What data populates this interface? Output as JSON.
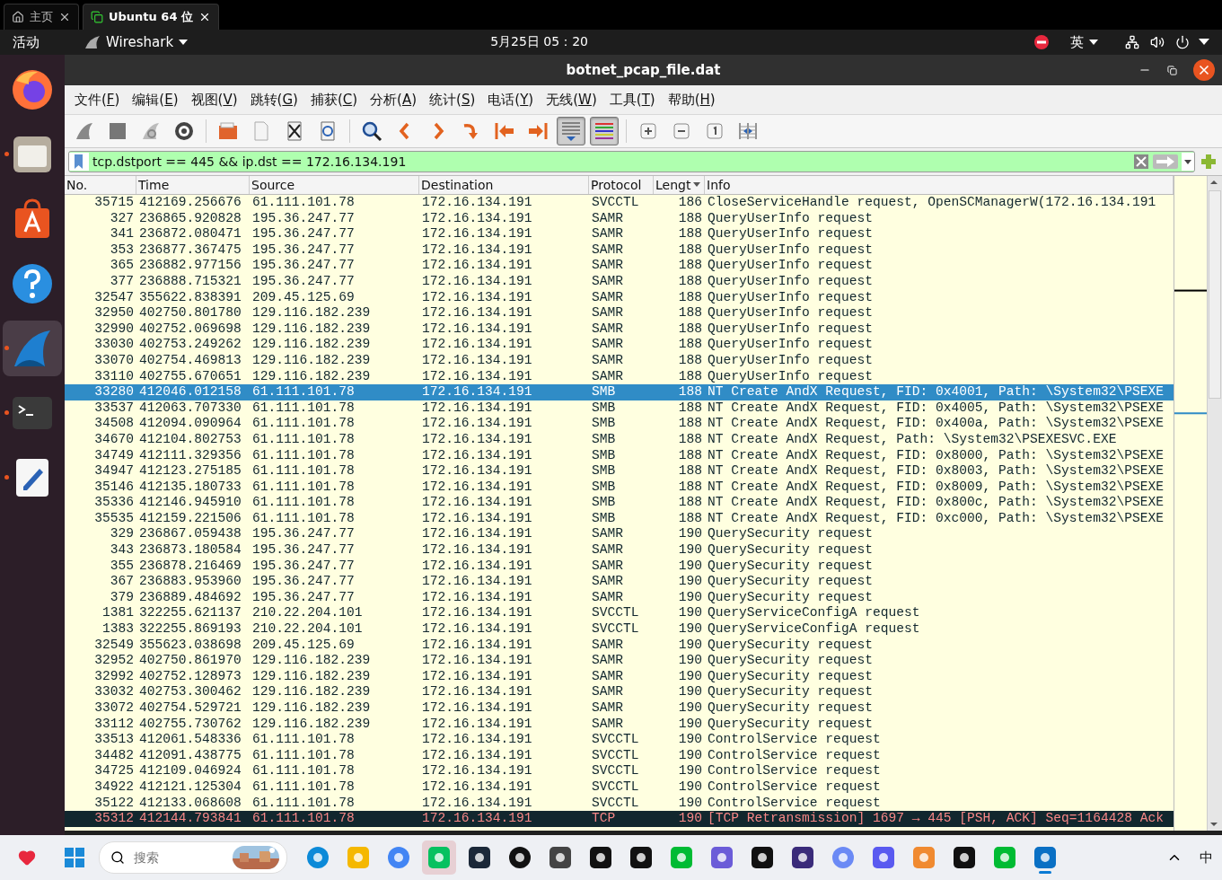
{
  "browser_tabs": [
    {
      "label": "主页",
      "selected": false
    },
    {
      "label": "Ubuntu 64 位",
      "selected": true
    }
  ],
  "top_panel": {
    "activities": "活动",
    "app_menu": "Wireshark",
    "clock": "5月25日  05：20",
    "input_method": "英"
  },
  "dock": [
    {
      "running": false,
      "focused": false
    },
    {
      "running": true,
      "focused": false
    },
    {
      "running": false,
      "focused": false
    },
    {
      "running": false,
      "focused": false
    },
    {
      "running": true,
      "focused": true
    },
    {
      "running": true,
      "focused": false
    },
    {
      "running": true,
      "focused": false
    }
  ],
  "window": {
    "title": "botnet_pcap_file.dat"
  },
  "menu": [
    "文件(F)",
    "编辑(E)",
    "视图(V)",
    "跳转(G)",
    "捕获(C)",
    "分析(A)",
    "统计(S)",
    "电话(Y)",
    "无线(W)",
    "工具(T)",
    "帮助(H)"
  ],
  "toolbar": [
    {
      "kind": "start",
      "pressed": false
    },
    {
      "kind": "stop",
      "pressed": false
    },
    {
      "kind": "restart",
      "pressed": false
    },
    {
      "kind": "options",
      "pressed": false
    },
    {
      "kind": "separator"
    },
    {
      "kind": "open",
      "pressed": false
    },
    {
      "kind": "save",
      "pressed": false
    },
    {
      "kind": "close",
      "pressed": false
    },
    {
      "kind": "reload",
      "pressed": false
    },
    {
      "kind": "separator"
    },
    {
      "kind": "find",
      "pressed": false
    },
    {
      "kind": "back",
      "pressed": false
    },
    {
      "kind": "forward",
      "pressed": false
    },
    {
      "kind": "goto",
      "pressed": false
    },
    {
      "kind": "first",
      "pressed": false
    },
    {
      "kind": "last",
      "pressed": false
    },
    {
      "kind": "autoscroll",
      "pressed": true
    },
    {
      "kind": "colorize",
      "pressed": true
    },
    {
      "kind": "separator"
    },
    {
      "kind": "zoom_in",
      "pressed": false
    },
    {
      "kind": "zoom_out",
      "pressed": false
    },
    {
      "kind": "normal_size",
      "pressed": false
    },
    {
      "kind": "resize_columns",
      "pressed": false
    }
  ],
  "filter": {
    "value": "tcp.dstport == 445 && ip.dst == 172.16.134.191",
    "valid": true
  },
  "table": {
    "columns": [
      "No.",
      "Time",
      "Source",
      "Destination",
      "Protocol",
      "Lengt",
      "Info"
    ],
    "rows": [
      {
        "no": "35715",
        "time": "412169.256676",
        "source": "61.111.101.78",
        "destination": "172.16.134.191",
        "protocol": "SVCCTL",
        "length": "186",
        "info": "CloseServiceHandle request, OpenSCManagerW(172.16.134.191",
        "kind": "normal",
        "selected": false
      },
      {
        "no": "327",
        "time": "236865.920828",
        "source": "195.36.247.77",
        "destination": "172.16.134.191",
        "protocol": "SAMR",
        "length": "188",
        "info": "QueryUserInfo request",
        "kind": "normal",
        "selected": false
      },
      {
        "no": "341",
        "time": "236872.080471",
        "source": "195.36.247.77",
        "destination": "172.16.134.191",
        "protocol": "SAMR",
        "length": "188",
        "info": "QueryUserInfo request",
        "kind": "normal",
        "selected": false
      },
      {
        "no": "353",
        "time": "236877.367475",
        "source": "195.36.247.77",
        "destination": "172.16.134.191",
        "protocol": "SAMR",
        "length": "188",
        "info": "QueryUserInfo request",
        "kind": "normal",
        "selected": false
      },
      {
        "no": "365",
        "time": "236882.977156",
        "source": "195.36.247.77",
        "destination": "172.16.134.191",
        "protocol": "SAMR",
        "length": "188",
        "info": "QueryUserInfo request",
        "kind": "normal",
        "selected": false
      },
      {
        "no": "377",
        "time": "236888.715321",
        "source": "195.36.247.77",
        "destination": "172.16.134.191",
        "protocol": "SAMR",
        "length": "188",
        "info": "QueryUserInfo request",
        "kind": "normal",
        "selected": false
      },
      {
        "no": "32547",
        "time": "355622.838391",
        "source": "209.45.125.69",
        "destination": "172.16.134.191",
        "protocol": "SAMR",
        "length": "188",
        "info": "QueryUserInfo request",
        "kind": "normal",
        "selected": false
      },
      {
        "no": "32950",
        "time": "402750.801780",
        "source": "129.116.182.239",
        "destination": "172.16.134.191",
        "protocol": "SAMR",
        "length": "188",
        "info": "QueryUserInfo request",
        "kind": "normal",
        "selected": false
      },
      {
        "no": "32990",
        "time": "402752.069698",
        "source": "129.116.182.239",
        "destination": "172.16.134.191",
        "protocol": "SAMR",
        "length": "188",
        "info": "QueryUserInfo request",
        "kind": "normal",
        "selected": false
      },
      {
        "no": "33030",
        "time": "402753.249262",
        "source": "129.116.182.239",
        "destination": "172.16.134.191",
        "protocol": "SAMR",
        "length": "188",
        "info": "QueryUserInfo request",
        "kind": "normal",
        "selected": false
      },
      {
        "no": "33070",
        "time": "402754.469813",
        "source": "129.116.182.239",
        "destination": "172.16.134.191",
        "protocol": "SAMR",
        "length": "188",
        "info": "QueryUserInfo request",
        "kind": "normal",
        "selected": false
      },
      {
        "no": "33110",
        "time": "402755.670651",
        "source": "129.116.182.239",
        "destination": "172.16.134.191",
        "protocol": "SAMR",
        "length": "188",
        "info": "QueryUserInfo request",
        "kind": "normal",
        "selected": false
      },
      {
        "no": "33280",
        "time": "412046.012158",
        "source": "61.111.101.78",
        "destination": "172.16.134.191",
        "protocol": "SMB",
        "length": "188",
        "info": "NT Create AndX Request, FID: 0x4001, Path: \\System32\\PSEXE",
        "kind": "normal",
        "selected": true
      },
      {
        "no": "33537",
        "time": "412063.707330",
        "source": "61.111.101.78",
        "destination": "172.16.134.191",
        "protocol": "SMB",
        "length": "188",
        "info": "NT Create AndX Request, FID: 0x4005, Path: \\System32\\PSEXE",
        "kind": "normal",
        "selected": false
      },
      {
        "no": "34508",
        "time": "412094.090964",
        "source": "61.111.101.78",
        "destination": "172.16.134.191",
        "protocol": "SMB",
        "length": "188",
        "info": "NT Create AndX Request, FID: 0x400a, Path: \\System32\\PSEXE",
        "kind": "normal",
        "selected": false
      },
      {
        "no": "34670",
        "time": "412104.802753",
        "source": "61.111.101.78",
        "destination": "172.16.134.191",
        "protocol": "SMB",
        "length": "188",
        "info": "NT Create AndX Request, Path: \\System32\\PSEXESVC.EXE",
        "kind": "normal",
        "selected": false
      },
      {
        "no": "34749",
        "time": "412111.329356",
        "source": "61.111.101.78",
        "destination": "172.16.134.191",
        "protocol": "SMB",
        "length": "188",
        "info": "NT Create AndX Request, FID: 0x8000, Path: \\System32\\PSEXE",
        "kind": "normal",
        "selected": false
      },
      {
        "no": "34947",
        "time": "412123.275185",
        "source": "61.111.101.78",
        "destination": "172.16.134.191",
        "protocol": "SMB",
        "length": "188",
        "info": "NT Create AndX Request, FID: 0x8003, Path: \\System32\\PSEXE",
        "kind": "normal",
        "selected": false
      },
      {
        "no": "35146",
        "time": "412135.180733",
        "source": "61.111.101.78",
        "destination": "172.16.134.191",
        "protocol": "SMB",
        "length": "188",
        "info": "NT Create AndX Request, FID: 0x8009, Path: \\System32\\PSEXE",
        "kind": "normal",
        "selected": false
      },
      {
        "no": "35336",
        "time": "412146.945910",
        "source": "61.111.101.78",
        "destination": "172.16.134.191",
        "protocol": "SMB",
        "length": "188",
        "info": "NT Create AndX Request, FID: 0x800c, Path: \\System32\\PSEXE",
        "kind": "normal",
        "selected": false
      },
      {
        "no": "35535",
        "time": "412159.221506",
        "source": "61.111.101.78",
        "destination": "172.16.134.191",
        "protocol": "SMB",
        "length": "188",
        "info": "NT Create AndX Request, FID: 0xc000, Path: \\System32\\PSEXE",
        "kind": "normal",
        "selected": false
      },
      {
        "no": "329",
        "time": "236867.059438",
        "source": "195.36.247.77",
        "destination": "172.16.134.191",
        "protocol": "SAMR",
        "length": "190",
        "info": "QuerySecurity request",
        "kind": "normal",
        "selected": false
      },
      {
        "no": "343",
        "time": "236873.180584",
        "source": "195.36.247.77",
        "destination": "172.16.134.191",
        "protocol": "SAMR",
        "length": "190",
        "info": "QuerySecurity request",
        "kind": "normal",
        "selected": false
      },
      {
        "no": "355",
        "time": "236878.216469",
        "source": "195.36.247.77",
        "destination": "172.16.134.191",
        "protocol": "SAMR",
        "length": "190",
        "info": "QuerySecurity request",
        "kind": "normal",
        "selected": false
      },
      {
        "no": "367",
        "time": "236883.953960",
        "source": "195.36.247.77",
        "destination": "172.16.134.191",
        "protocol": "SAMR",
        "length": "190",
        "info": "QuerySecurity request",
        "kind": "normal",
        "selected": false
      },
      {
        "no": "379",
        "time": "236889.484692",
        "source": "195.36.247.77",
        "destination": "172.16.134.191",
        "protocol": "SAMR",
        "length": "190",
        "info": "QuerySecurity request",
        "kind": "normal",
        "selected": false
      },
      {
        "no": "1381",
        "time": "322255.621137",
        "source": "210.22.204.101",
        "destination": "172.16.134.191",
        "protocol": "SVCCTL",
        "length": "190",
        "info": "QueryServiceConfigA request",
        "kind": "normal",
        "selected": false
      },
      {
        "no": "1383",
        "time": "322255.869193",
        "source": "210.22.204.101",
        "destination": "172.16.134.191",
        "protocol": "SVCCTL",
        "length": "190",
        "info": "QueryServiceConfigA request",
        "kind": "normal",
        "selected": false
      },
      {
        "no": "32549",
        "time": "355623.038698",
        "source": "209.45.125.69",
        "destination": "172.16.134.191",
        "protocol": "SAMR",
        "length": "190",
        "info": "QuerySecurity request",
        "kind": "normal",
        "selected": false
      },
      {
        "no": "32952",
        "time": "402750.861970",
        "source": "129.116.182.239",
        "destination": "172.16.134.191",
        "protocol": "SAMR",
        "length": "190",
        "info": "QuerySecurity request",
        "kind": "normal",
        "selected": false
      },
      {
        "no": "32992",
        "time": "402752.128973",
        "source": "129.116.182.239",
        "destination": "172.16.134.191",
        "protocol": "SAMR",
        "length": "190",
        "info": "QuerySecurity request",
        "kind": "normal",
        "selected": false
      },
      {
        "no": "33032",
        "time": "402753.300462",
        "source": "129.116.182.239",
        "destination": "172.16.134.191",
        "protocol": "SAMR",
        "length": "190",
        "info": "QuerySecurity request",
        "kind": "normal",
        "selected": false
      },
      {
        "no": "33072",
        "time": "402754.529721",
        "source": "129.116.182.239",
        "destination": "172.16.134.191",
        "protocol": "SAMR",
        "length": "190",
        "info": "QuerySecurity request",
        "kind": "normal",
        "selected": false
      },
      {
        "no": "33112",
        "time": "402755.730762",
        "source": "129.116.182.239",
        "destination": "172.16.134.191",
        "protocol": "SAMR",
        "length": "190",
        "info": "QuerySecurity request",
        "kind": "normal",
        "selected": false
      },
      {
        "no": "33513",
        "time": "412061.548336",
        "source": "61.111.101.78",
        "destination": "172.16.134.191",
        "protocol": "SVCCTL",
        "length": "190",
        "info": "ControlService request",
        "kind": "normal",
        "selected": false
      },
      {
        "no": "34482",
        "time": "412091.438775",
        "source": "61.111.101.78",
        "destination": "172.16.134.191",
        "protocol": "SVCCTL",
        "length": "190",
        "info": "ControlService request",
        "kind": "normal",
        "selected": false
      },
      {
        "no": "34725",
        "time": "412109.046924",
        "source": "61.111.101.78",
        "destination": "172.16.134.191",
        "protocol": "SVCCTL",
        "length": "190",
        "info": "ControlService request",
        "kind": "normal",
        "selected": false
      },
      {
        "no": "34922",
        "time": "412121.125304",
        "source": "61.111.101.78",
        "destination": "172.16.134.191",
        "protocol": "SVCCTL",
        "length": "190",
        "info": "ControlService request",
        "kind": "normal",
        "selected": false
      },
      {
        "no": "35122",
        "time": "412133.068608",
        "source": "61.111.101.78",
        "destination": "172.16.134.191",
        "protocol": "SVCCTL",
        "length": "190",
        "info": "ControlService request",
        "kind": "normal",
        "selected": false
      },
      {
        "no": "35312",
        "time": "412144.793841",
        "source": "61.111.101.78",
        "destination": "172.16.134.191",
        "protocol": "TCP",
        "length": "190",
        "info": "[TCP Retransmission] 1697 → 445 [PSH, ACK] Seq=1164428 Ack",
        "kind": "bad",
        "selected": false
      }
    ]
  },
  "taskbar": {
    "search_placeholder": "搜索",
    "input_method": "中",
    "apps": [
      {
        "active": false
      },
      {
        "active": false
      },
      {
        "active": false
      },
      {
        "active": true
      },
      {
        "active": false
      },
      {
        "active": false
      },
      {
        "active": false
      },
      {
        "active": false
      },
      {
        "active": false
      },
      {
        "active": false
      },
      {
        "active": false
      },
      {
        "active": false
      },
      {
        "active": false
      },
      {
        "active": false
      },
      {
        "active": false
      },
      {
        "active": false
      },
      {
        "active": false
      },
      {
        "active": false
      },
      {
        "active": true
      }
    ]
  }
}
